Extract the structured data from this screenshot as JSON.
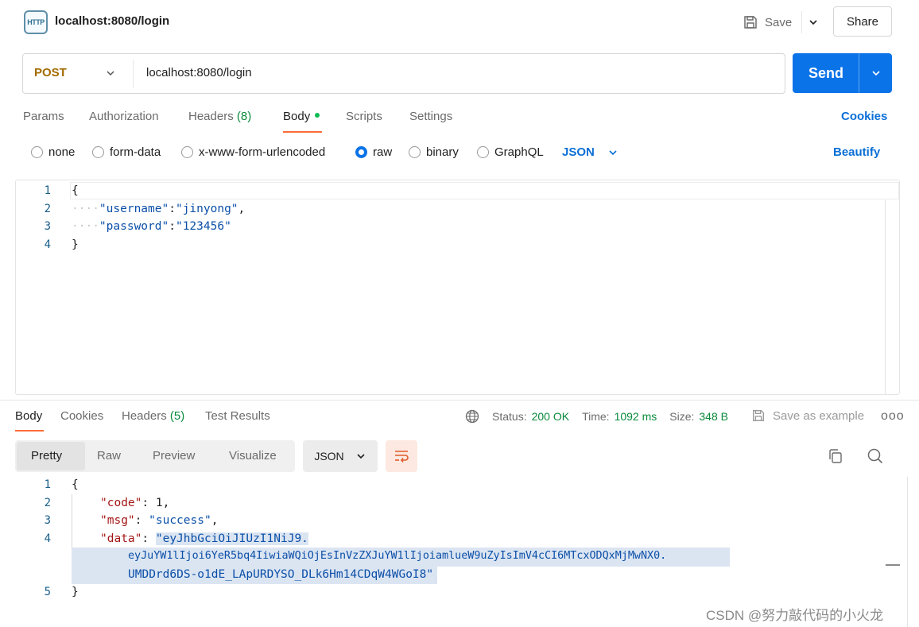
{
  "header": {
    "icon_label": "HTTP",
    "title": "localhost:8080/login",
    "save_label": "Save",
    "share_label": "Share"
  },
  "request": {
    "method": "POST",
    "url": "localhost:8080/login",
    "send_label": "Send"
  },
  "request_tabs": {
    "params": "Params",
    "authorization": "Authorization",
    "headers": "Headers",
    "headers_count": "(8)",
    "body": "Body",
    "scripts": "Scripts",
    "settings": "Settings",
    "cookies": "Cookies"
  },
  "body_types": {
    "none": "none",
    "form_data": "form-data",
    "urlencoded": "x-www-form-urlencoded",
    "raw": "raw",
    "binary": "binary",
    "graphql": "GraphQL",
    "selected": "raw",
    "format": "JSON",
    "beautify": "Beautify"
  },
  "request_body": {
    "line_numbers": [
      "1",
      "2",
      "3",
      "4"
    ],
    "open_brace": "{",
    "close_brace": "}",
    "username_key": "\"username\"",
    "username_value": "\"jinyong\"",
    "password_key": "\"password\"",
    "password_value": "\"123456\""
  },
  "response_tabs": {
    "body": "Body",
    "cookies": "Cookies",
    "headers": "Headers",
    "headers_count": "(5)",
    "test_results": "Test Results"
  },
  "response_status": {
    "status_label": "Status:",
    "status_value": "200 OK",
    "time_label": "Time:",
    "time_value": "1092 ms",
    "size_label": "Size:",
    "size_value": "348 B",
    "save_example": "Save as example",
    "more": "ooo"
  },
  "response_toolbar": {
    "pretty": "Pretty",
    "raw": "Raw",
    "preview": "Preview",
    "visualize": "Visualize",
    "format": "JSON"
  },
  "response_body": {
    "line_numbers": [
      "1",
      "2",
      "3",
      "4",
      "5"
    ],
    "open_brace": "{",
    "close_brace": "}",
    "code_key": "\"code\"",
    "code_value": "1",
    "msg_key": "\"msg\"",
    "msg_value": "\"success\"",
    "data_key": "\"data\"",
    "data_value_1": "\"eyJhbGciOiJIUzI1NiJ9.",
    "data_value_2": "eyJuYW1lIjoi6YeR5bq4IiwiaWQiOjEsInVzZXJuYW1lIjoiamlueW9uZyIsImV4cCI6MTcxODQxMjMwNX0.",
    "data_value_3": "UMDDrd6DS-o1dE_LApURDYSO_DLk6Hm14CDqW4WGoI8\""
  },
  "watermark": "CSDN @努力敲代码的小火龙",
  "colors": {
    "accent_orange": "#ff6c37",
    "send_blue": "#0b73e8",
    "link_blue": "#0a6fd6",
    "method_post": "#a36b00",
    "status_green": "#0a8a3c"
  }
}
